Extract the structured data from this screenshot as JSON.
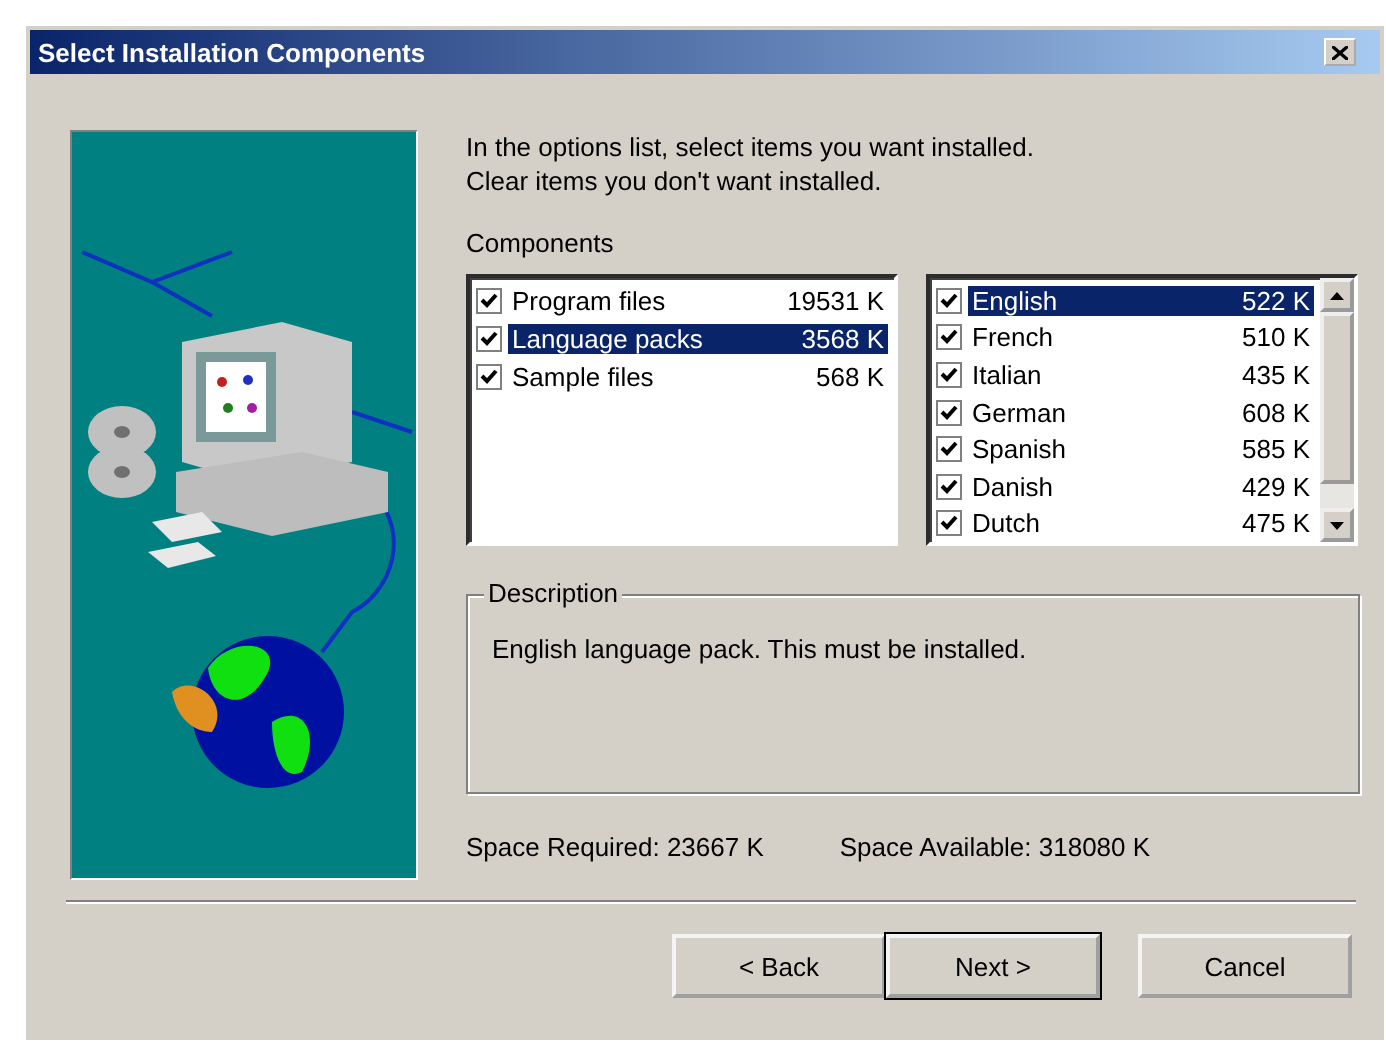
{
  "window": {
    "title": "Select Installation Components"
  },
  "instructions": [
    "In the options list, select items you want installed.",
    "Clear items you don't want installed."
  ],
  "components": {
    "label": "Components",
    "items": [
      {
        "name": "Program files",
        "size": "19531 K",
        "checked": true,
        "selected": false
      },
      {
        "name": "Language packs",
        "size": "3568 K",
        "checked": true,
        "selected": true
      },
      {
        "name": "Sample files",
        "size": "568 K",
        "checked": true,
        "selected": false
      }
    ]
  },
  "subcomponents": [
    {
      "name": "English",
      "size": "522 K",
      "checked": true,
      "selected": true
    },
    {
      "name": "French",
      "size": "510 K",
      "checked": true,
      "selected": false
    },
    {
      "name": "Italian",
      "size": "435 K",
      "checked": true,
      "selected": false
    },
    {
      "name": "German",
      "size": "608 K",
      "checked": true,
      "selected": false
    },
    {
      "name": "Spanish",
      "size": "585 K",
      "checked": true,
      "selected": false
    },
    {
      "name": "Danish",
      "size": "429 K",
      "checked": true,
      "selected": false
    },
    {
      "name": "Dutch",
      "size": "475 K",
      "checked": true,
      "selected": false
    }
  ],
  "description": {
    "label": "Description",
    "text": "English language pack. This must be installed."
  },
  "space": {
    "required_label": "Space Required:",
    "required": "23667 K",
    "available_label": "Space Available:",
    "available": "318080 K"
  },
  "buttons": [
    {
      "label": "< Back",
      "default": false
    },
    {
      "label": "Next >",
      "default": true
    },
    {
      "label": "Cancel",
      "default": false
    }
  ]
}
